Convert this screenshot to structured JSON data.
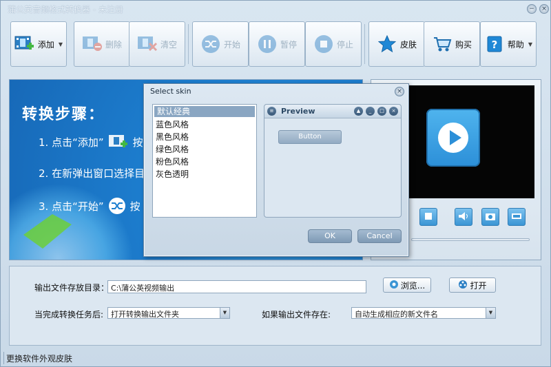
{
  "window": {
    "title": "蒲公英音频格式转换器 - 未注册",
    "minimize_glyph": "−",
    "close_glyph": "×"
  },
  "toolbar": {
    "add": {
      "label": "添加",
      "icon": "film-add-icon",
      "dropdown": "▼"
    },
    "delete": {
      "label": "删除",
      "icon": "film-remove-icon"
    },
    "clear": {
      "label": "清空",
      "icon": "film-clear-icon"
    },
    "start": {
      "label": "开始",
      "icon": "shuffle-icon"
    },
    "pause": {
      "label": "暂停",
      "icon": "pause-icon"
    },
    "stop": {
      "label": "停止",
      "icon": "stop-icon"
    },
    "skin": {
      "label": "皮肤",
      "icon": "star-icon"
    },
    "buy": {
      "label": "购买",
      "icon": "cart-icon"
    },
    "help": {
      "label": "帮助",
      "icon": "help-icon",
      "dropdown": "▼"
    }
  },
  "banner": {
    "title": "转换步骤：",
    "step1": "1. 点击“添加”",
    "step1_tail": "按",
    "step2": "2. 在新弹出窗口选择目",
    "step3": "3. 点击“开始”",
    "step3_tail": "按"
  },
  "bottom": {
    "output_dir_label": "输出文件存放目录：",
    "output_dir_value": "C:\\蒲公英视频输出",
    "browse_label": "浏览...",
    "open_label": "打开",
    "on_complete_label": "当完成转换任务后:",
    "on_complete_value": "打开转换输出文件夹",
    "if_exists_label": "如果输出文件存在:",
    "if_exists_value": "自动生成相应的新文件名"
  },
  "status": {
    "text": "更换软件外观皮肤"
  },
  "dialog": {
    "title": "Select skin",
    "close_glyph": "×",
    "skins": [
      "默认经典",
      "蓝色风格",
      "黑色风格",
      "绿色风格",
      "粉色风格",
      "灰色透明"
    ],
    "preview_title": "Preview",
    "preview_button": "Button",
    "ok_label": "OK",
    "cancel_label": "Cancel"
  },
  "colors": {
    "banner_blue": "#1d7fd0",
    "accent_green": "#6ccf3a",
    "play_blue": "#3a9ee4"
  }
}
